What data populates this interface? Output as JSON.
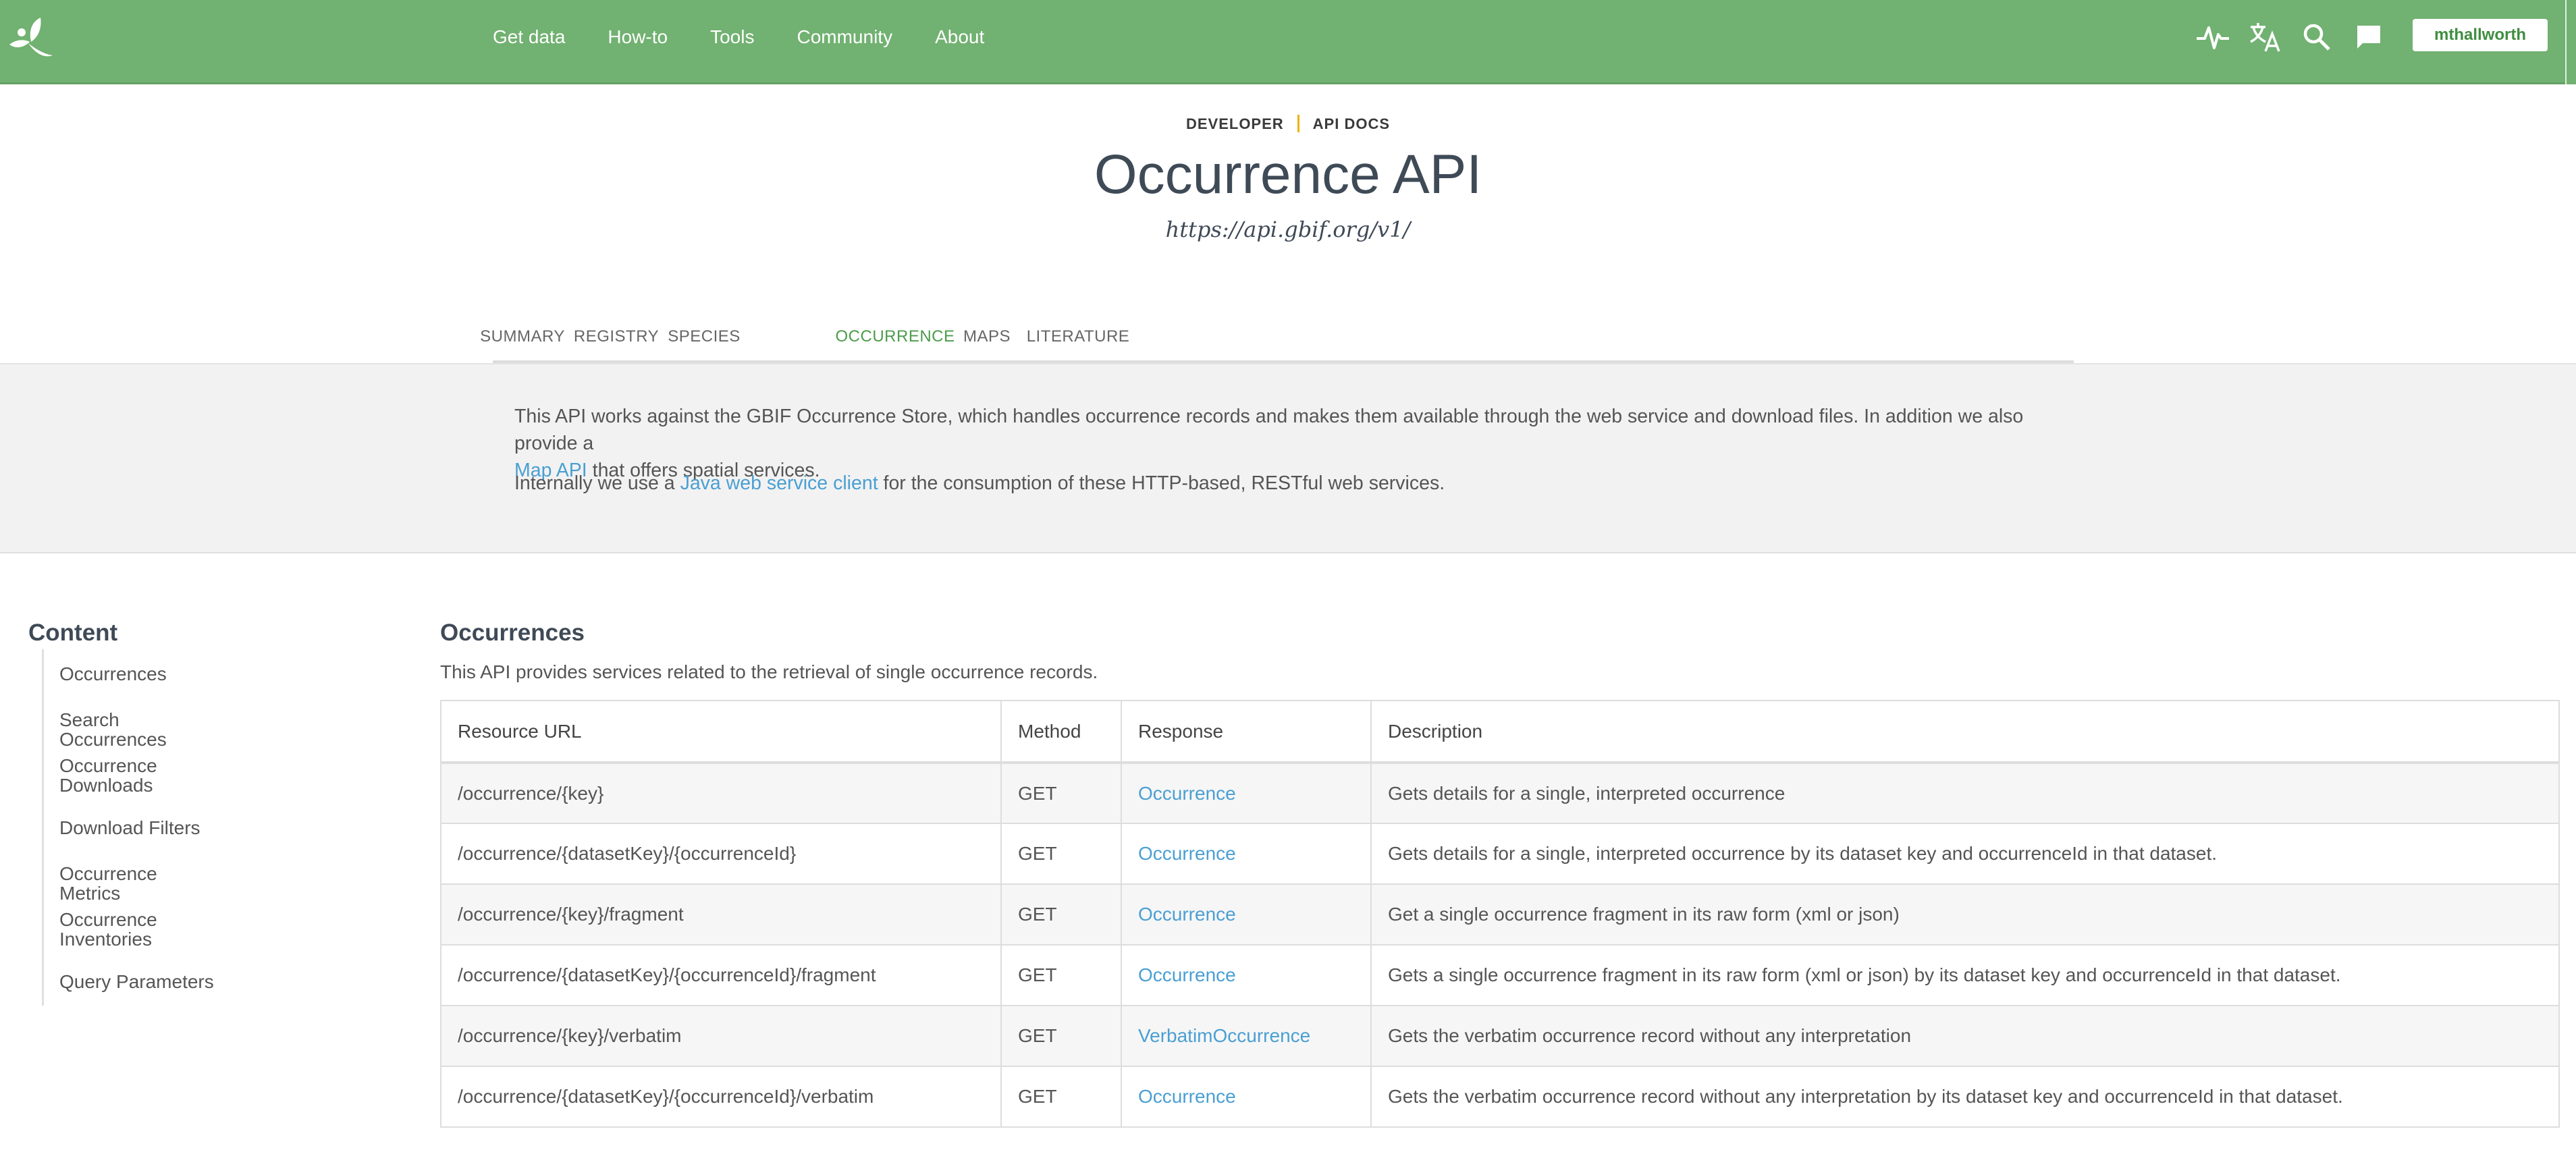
{
  "topbar": {
    "nav": [
      "Get data",
      "How-to",
      "Tools",
      "Community",
      "About"
    ],
    "icons": [
      "pulse-icon",
      "translate-icon",
      "search-icon",
      "chat-icon"
    ],
    "user_label": "mthallworth",
    "brand_color": "#71b171"
  },
  "header": {
    "crumb_1": "DEVELOPER",
    "crumb_2": "API DOCS",
    "title": "Occurrence API",
    "base_url": "https://api.gbif.org/v1/"
  },
  "tabs": [
    "SUMMARY",
    "REGISTRY",
    "SPECIES",
    "OCCURRENCE",
    "MAPS",
    "LITERATURE"
  ],
  "active_tab": "OCCURRENCE",
  "intro": {
    "p1_text": "This API works against the GBIF Occurrence Store, which handles occurrence records and makes them available through the web service and download files. In addition we also provide a",
    "p1_link": "Map API",
    "p1_tail": " that offers spatial services.",
    "p2_head": "Internally we use a ",
    "p2_link": "Java web service client",
    "p2_tail": " for the consumption of these HTTP-based, RESTful web services."
  },
  "sidebar": {
    "heading": "Content",
    "items": [
      {
        "line1": "Occurrences",
        "line2": ""
      },
      {
        "line1": "Search Occurrences",
        "line2": ""
      },
      {
        "line1": "Occurrence",
        "line2": "Downloads"
      },
      {
        "line1": "Download Filters",
        "line2": ""
      },
      {
        "line1": "Occurrence Metrics",
        "line2": ""
      },
      {
        "line1": "Occurrence",
        "line2": "Inventories"
      },
      {
        "line1": "Query Parameters",
        "line2": ""
      }
    ]
  },
  "main": {
    "heading": "Occurrences",
    "description": "This API provides services related to the retrieval of single occurrence records.",
    "columns": [
      "Resource URL",
      "Method",
      "Response",
      "Description"
    ],
    "rows": [
      {
        "url": "/occurrence/{key}",
        "method": "GET",
        "response": "Occurrence",
        "description": "Gets details for a single, interpreted occurrence"
      },
      {
        "url": "/occurrence/{datasetKey}/{occurrenceId}",
        "method": "GET",
        "response": "Occurrence",
        "description": "Gets details for a single, interpreted occurrence by its dataset key and occurrenceId in that dataset."
      },
      {
        "url": "/occurrence/{key}/fragment",
        "method": "GET",
        "response": "Occurrence",
        "description": "Get a single occurrence fragment in its raw form (xml or json)"
      },
      {
        "url": "/occurrence/{datasetKey}/{occurrenceId}/fragment",
        "method": "GET",
        "response": "Occurrence",
        "description": "Gets a single occurrence fragment in its raw form (xml or json) by its dataset key and occurrenceId in that dataset."
      },
      {
        "url": "/occurrence/{key}/verbatim",
        "method": "GET",
        "response": "VerbatimOccurrence",
        "description": "Gets the verbatim occurrence record without any interpretation"
      },
      {
        "url": "/occurrence/{datasetKey}/{occurrenceId}/verbatim",
        "method": "GET",
        "response": "Occurrence",
        "description": "Gets the verbatim occurrence record without any interpretation by its dataset key and occurrenceId in that dataset."
      }
    ]
  }
}
